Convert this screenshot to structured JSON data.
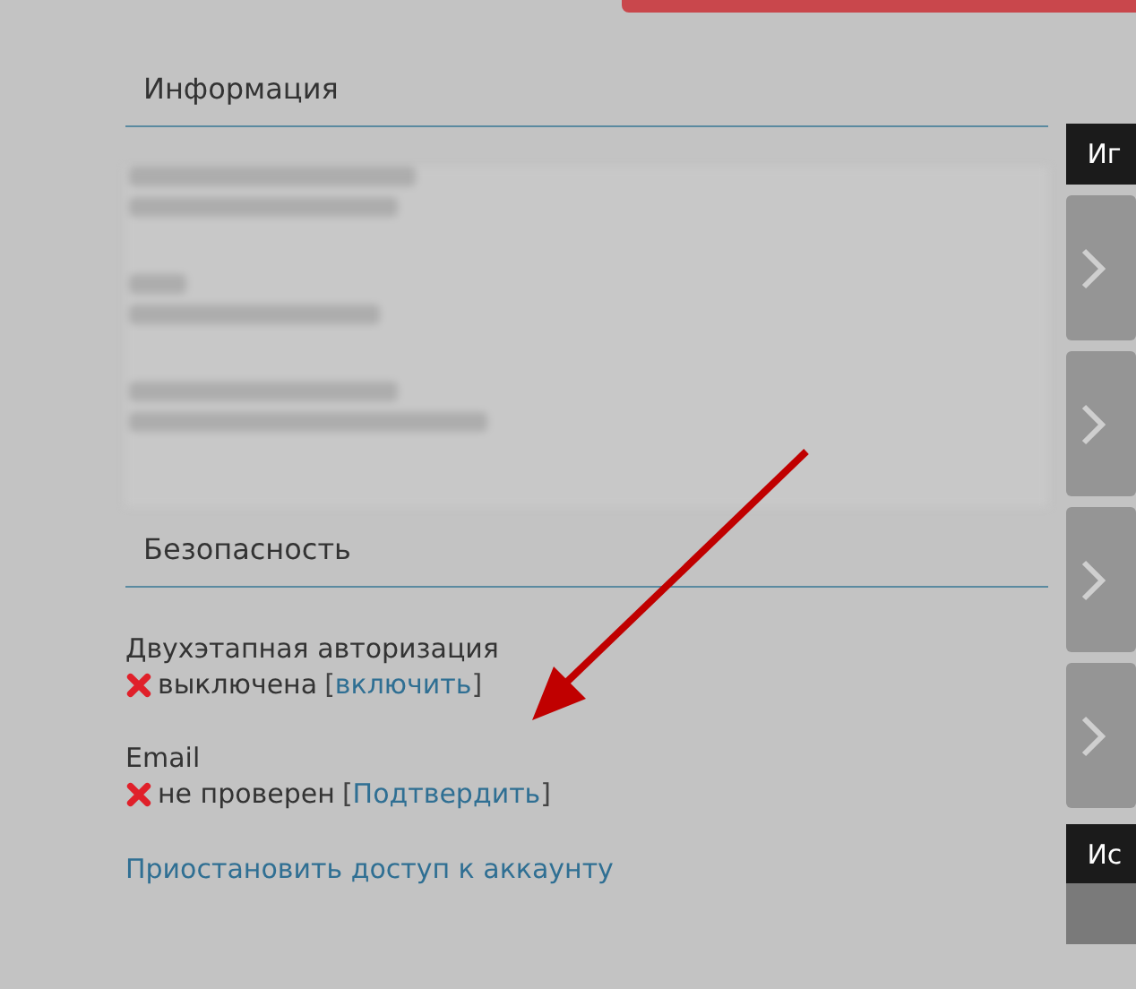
{
  "info": {
    "title": "Информация"
  },
  "security": {
    "title": "Безопасность",
    "items": [
      {
        "label": "Двухэтапная авторизация",
        "ok": false,
        "status": "выключена",
        "open": "[",
        "action": "включить",
        "close": "]"
      },
      {
        "label": "Email",
        "ok": false,
        "status": "не проверен",
        "open": "[",
        "action": "Подтвердить",
        "close": "]"
      }
    ],
    "suspend_link": "Приостановить доступ к аккаунту"
  },
  "side": {
    "header_1": "Иг",
    "cards": [
      {
        "kind": "chevron"
      },
      {
        "kind": "chevron"
      },
      {
        "kind": "chevron"
      },
      {
        "kind": "chevron"
      }
    ],
    "header_2": "Ис"
  }
}
